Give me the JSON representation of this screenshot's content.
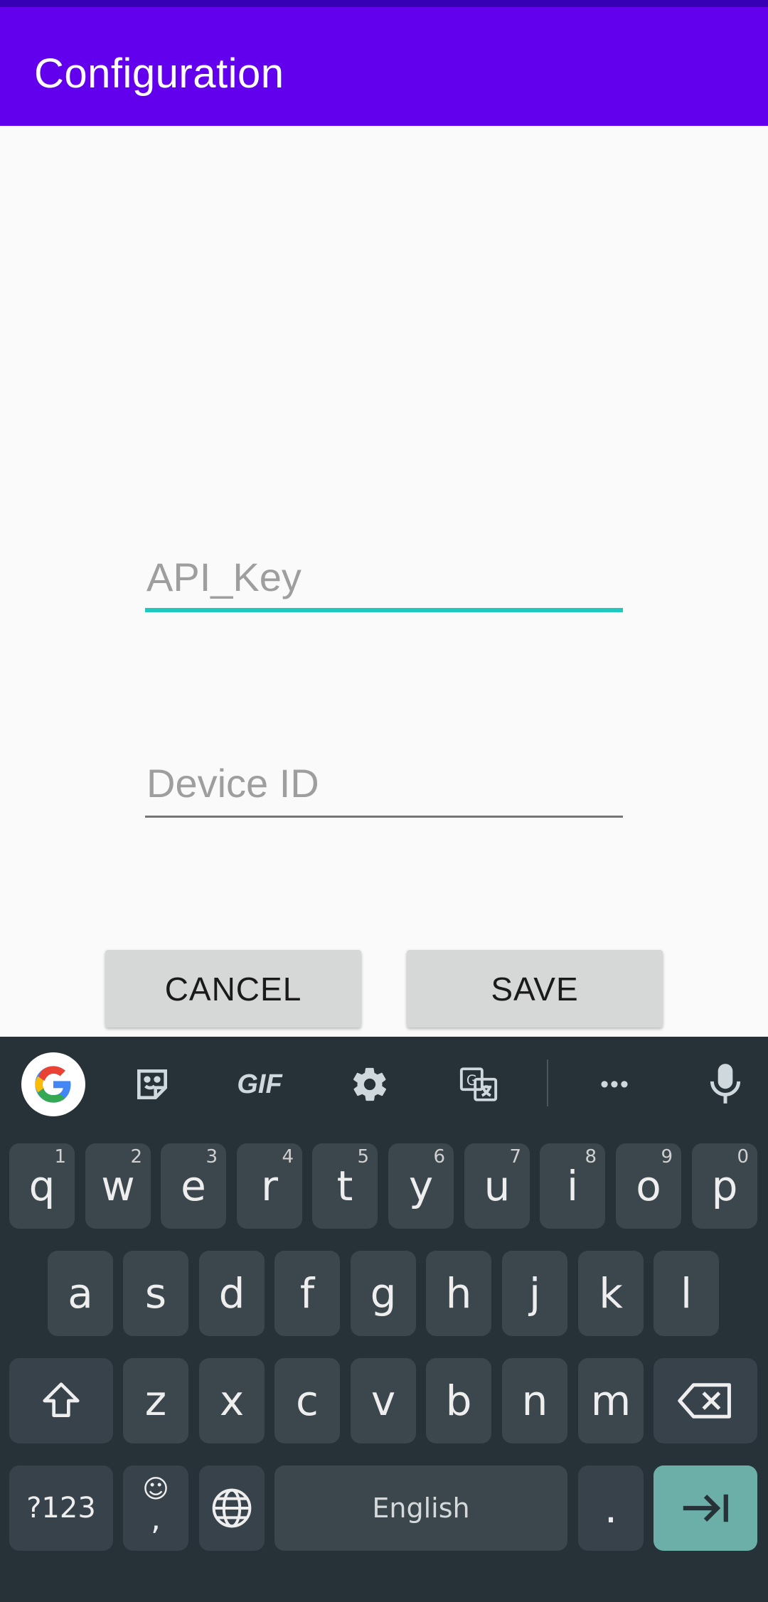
{
  "app_bar": {
    "title": "Configuration"
  },
  "form": {
    "api_key_placeholder": "API_Key",
    "device_id_placeholder": "Device ID",
    "cancel_label": "CANCEL",
    "save_label": "SAVE"
  },
  "keyboard": {
    "toolbar_icons": [
      "google-icon",
      "sticker-icon",
      "gif-icon",
      "settings-icon",
      "translate-icon",
      "more-icon",
      "mic-icon"
    ],
    "gif_label": "GIF",
    "more_label": "•••",
    "row1": [
      "q",
      "w",
      "e",
      "r",
      "t",
      "y",
      "u",
      "i",
      "o",
      "p"
    ],
    "row1_hints": [
      "1",
      "2",
      "3",
      "4",
      "5",
      "6",
      "7",
      "8",
      "9",
      "0"
    ],
    "row2": [
      "a",
      "s",
      "d",
      "f",
      "g",
      "h",
      "j",
      "k",
      "l"
    ],
    "row3": [
      "z",
      "x",
      "c",
      "v",
      "b",
      "n",
      "m"
    ],
    "symbols_label": "?123",
    "emoji_label": "☺",
    "comma_label": ",",
    "space_label": "English",
    "period_label": "."
  },
  "colors": {
    "app_bar": "#6200ee",
    "status_bar": "#3700b3",
    "focus_underline": "#1fc9c0",
    "keyboard_bg": "#263238",
    "key_bg": "#3c474d",
    "action_key": "#6cafa8"
  }
}
